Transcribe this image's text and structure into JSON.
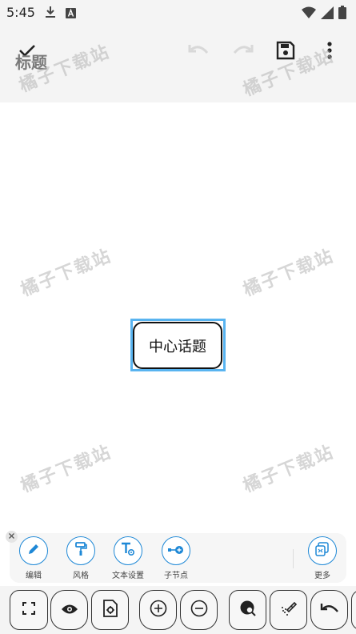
{
  "status": {
    "time": "5:45",
    "icons": [
      "download-icon",
      "a-box-icon",
      "wifi-icon",
      "signal-icon",
      "battery-icon"
    ]
  },
  "toolbar": {
    "title": "标题",
    "icons": [
      "check-icon",
      "undo-icon",
      "redo-icon",
      "save-icon",
      "more-vert-icon"
    ]
  },
  "canvas": {
    "center_node": "中心话题",
    "watermark": "橘子下载站"
  },
  "actions": [
    {
      "label": "编辑",
      "icon": "pencil-icon"
    },
    {
      "label": "风格",
      "icon": "paint-roller-icon"
    },
    {
      "label": "文本设置",
      "icon": "text-settings-icon"
    },
    {
      "label": "子节点",
      "icon": "child-node-icon"
    },
    {
      "label": "更多",
      "icon": "more-icon"
    }
  ],
  "bottom_toolbar": [
    "fullscreen-icon",
    "eye-icon",
    "doc-settings-icon",
    "zoom-in-icon",
    "zoom-out-icon",
    "search-globe-icon",
    "magic-brush-icon",
    "undo-icon"
  ],
  "colors": {
    "accent": "#1e88d6",
    "selection": "#59b4f0",
    "background": "#f4f4f4"
  }
}
